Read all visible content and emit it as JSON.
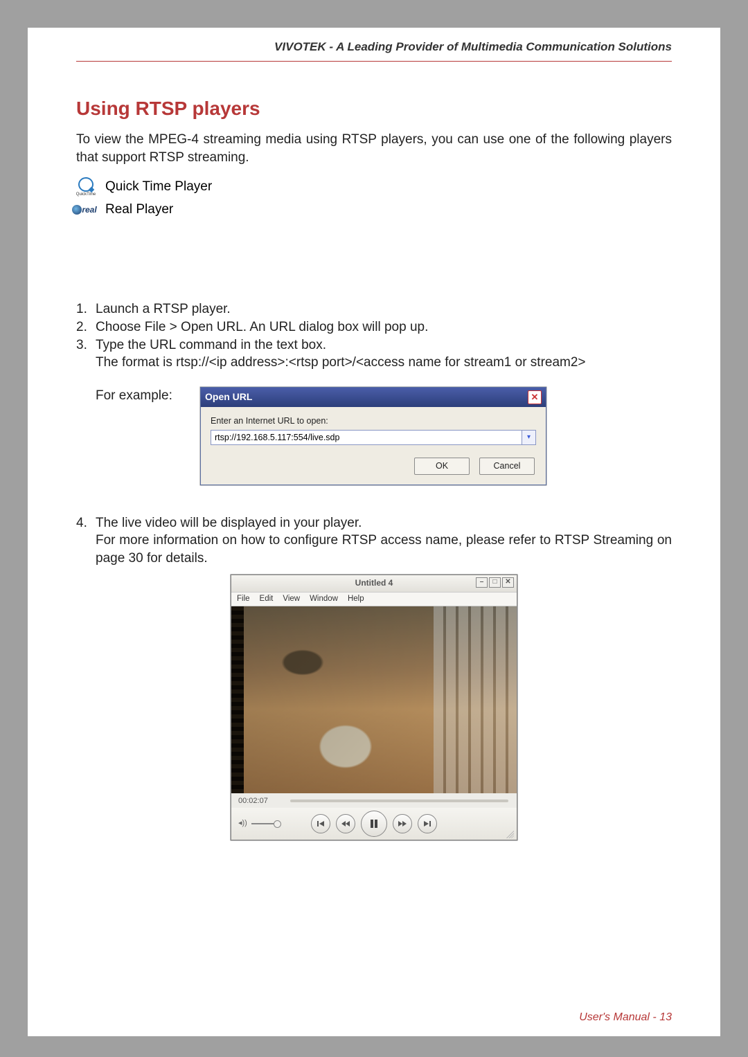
{
  "header": "VIVOTEK - A Leading Provider of Multimedia Communication Solutions",
  "section_title": "Using RTSP players",
  "intro": "To view the MPEG-4 streaming media using RTSP players, you can use one of the following players that support RTSP streaming.",
  "players": {
    "quicktime": {
      "label": "Quick Time Player",
      "icon_sub": "QuickTime"
    },
    "real": {
      "label": "Real Player",
      "icon_text": "real"
    }
  },
  "steps": {
    "s1": {
      "num": "1.",
      "text": "Launch a RTSP player."
    },
    "s2": {
      "num": "2.",
      "text": "Choose File > Open URL. An URL dialog box will pop up."
    },
    "s3": {
      "num": "3.",
      "text": "Type the URL command in the text box.",
      "sub": "The format is rtsp://<ip address>:<rtsp port>/<access name for stream1 or stream2>"
    },
    "example_label": "For example:",
    "s4": {
      "num": "4.",
      "text": "The live video will be displayed in your player.",
      "sub": "For more information on how to configure RTSP access name, please refer to RTSP Streaming on page 30 for details."
    }
  },
  "dialog": {
    "title": "Open URL",
    "label": "Enter an Internet URL to open:",
    "value": "rtsp://192.168.5.117:554/live.sdp",
    "ok": "OK",
    "cancel": "Cancel"
  },
  "player_window": {
    "title": "Untitled 4",
    "menus": [
      "File",
      "Edit",
      "View",
      "Window",
      "Help"
    ],
    "time": "00:02:07",
    "speaker_glyph": "◂))"
  },
  "footer": "User's Manual - 13"
}
